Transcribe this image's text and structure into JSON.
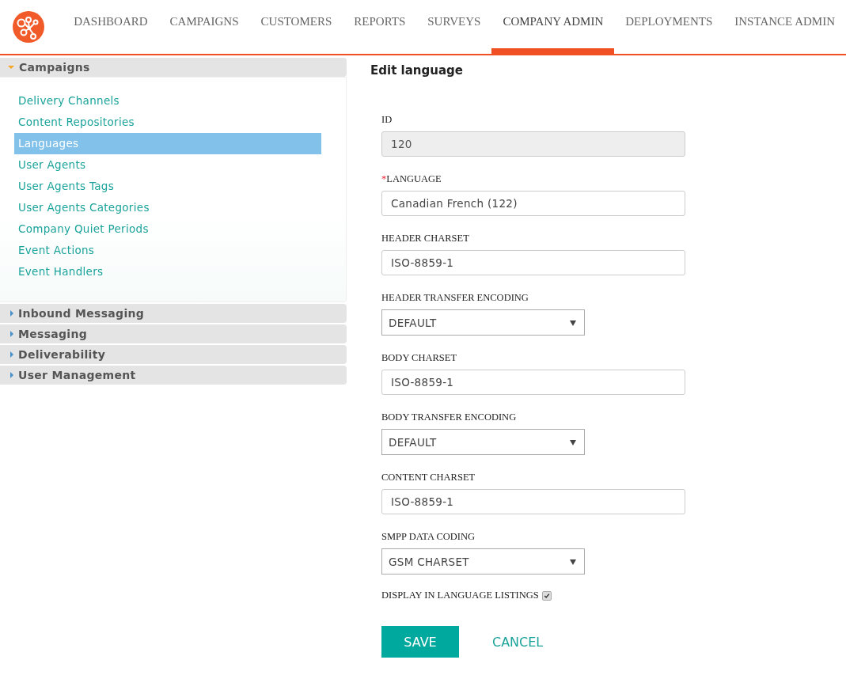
{
  "nav": {
    "tabs": [
      {
        "label": "DASHBOARD",
        "selected": false
      },
      {
        "label": "CAMPAIGNS",
        "selected": false
      },
      {
        "label": "CUSTOMERS",
        "selected": false
      },
      {
        "label": "REPORTS",
        "selected": false
      },
      {
        "label": "SURVEYS",
        "selected": false
      },
      {
        "label": "COMPANY ADMIN",
        "selected": true
      },
      {
        "label": "DEPLOYMENTS",
        "selected": false
      },
      {
        "label": "INSTANCE ADMIN",
        "selected": false
      }
    ]
  },
  "sidebar": {
    "sections": [
      {
        "title": "Campaigns",
        "expanded": true,
        "items": [
          {
            "label": "Delivery Channels",
            "selected": false
          },
          {
            "label": "Content Repositories",
            "selected": false
          },
          {
            "label": "Languages",
            "selected": true
          },
          {
            "label": "User Agents",
            "selected": false
          },
          {
            "label": "User Agents Tags",
            "selected": false
          },
          {
            "label": "User Agents Categories",
            "selected": false
          },
          {
            "label": "Company Quiet Periods",
            "selected": false
          },
          {
            "label": "Event Actions",
            "selected": false
          },
          {
            "label": "Event Handlers",
            "selected": false
          }
        ]
      },
      {
        "title": "Inbound Messaging",
        "expanded": false
      },
      {
        "title": "Messaging",
        "expanded": false
      },
      {
        "title": "Deliverability",
        "expanded": false
      },
      {
        "title": "User Management",
        "expanded": false
      }
    ]
  },
  "form": {
    "title": "Edit language",
    "fields": [
      {
        "kind": "text",
        "label": "ID",
        "value": "120",
        "required": false,
        "disabled": true
      },
      {
        "kind": "text",
        "label": "LANGUAGE",
        "value": "Canadian French (122)",
        "required": true,
        "disabled": false
      },
      {
        "kind": "text",
        "label": "HEADER CHARSET",
        "value": "ISO-8859-1",
        "required": false,
        "disabled": false
      },
      {
        "kind": "select",
        "label": "HEADER TRANSFER ENCODING",
        "value": "DEFAULT",
        "required": false
      },
      {
        "kind": "text",
        "label": "BODY CHARSET",
        "value": "ISO-8859-1",
        "required": false,
        "disabled": false
      },
      {
        "kind": "select",
        "label": "BODY TRANSFER ENCODING",
        "value": "DEFAULT",
        "required": false
      },
      {
        "kind": "text",
        "label": "CONTENT CHARSET",
        "value": "ISO-8859-1",
        "required": false,
        "disabled": false
      },
      {
        "kind": "select",
        "label": "SMPP DATA CODING",
        "value": "GSM CHARSET",
        "required": false
      },
      {
        "kind": "checkbox",
        "label": "DISPLAY IN LANGUAGE LISTINGS",
        "checked": true,
        "required": false,
        "disabled": true
      }
    ],
    "required_mark": "*",
    "buttons": [
      {
        "kind": "primary",
        "label": "SAVE"
      },
      {
        "kind": "link",
        "label": "CANCEL"
      }
    ]
  }
}
